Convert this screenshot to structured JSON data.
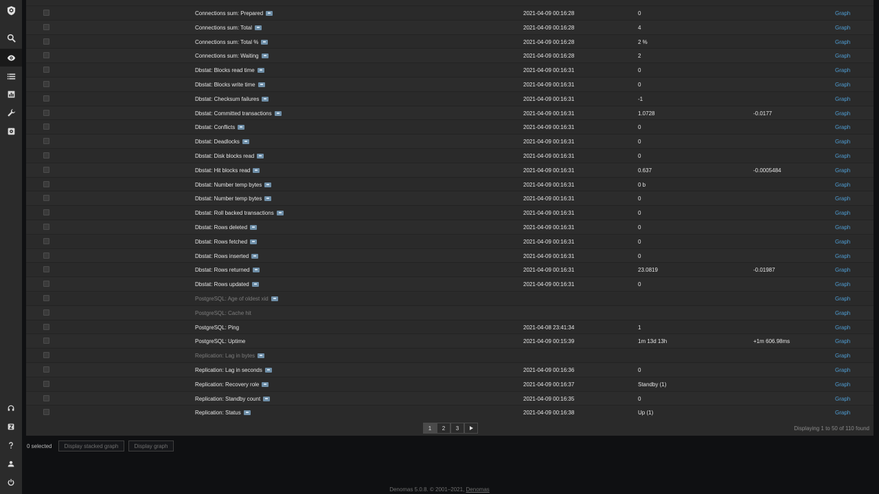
{
  "sidebar": {
    "top": [
      "logo-icon",
      "search-icon",
      "eye-icon",
      "list-icon",
      "chart-icon",
      "wrench-icon",
      "cog-icon"
    ],
    "bottom": [
      "headset-icon",
      "z-icon",
      "help-icon",
      "user-icon",
      "power-icon"
    ]
  },
  "rows": [
    {
      "name": "Connections sum: Prepared",
      "tag": true,
      "time": "2021-04-09 00:16:28",
      "value": "0",
      "change": "",
      "link": "Graph"
    },
    {
      "name": "Connections sum: Total",
      "tag": true,
      "time": "2021-04-09 00:16:28",
      "value": "4",
      "change": "",
      "link": "Graph"
    },
    {
      "name": "Connections sum: Total %",
      "tag": true,
      "time": "2021-04-09 00:16:28",
      "value": "2 %",
      "change": "",
      "link": "Graph"
    },
    {
      "name": "Connections sum: Waiting",
      "tag": true,
      "time": "2021-04-09 00:16:28",
      "value": "2",
      "change": "",
      "link": "Graph"
    },
    {
      "name": "Dbstat: Blocks read time",
      "tag": true,
      "time": "2021-04-09 00:16:31",
      "value": "0",
      "change": "",
      "link": "Graph"
    },
    {
      "name": "Dbstat: Blocks write time",
      "tag": true,
      "time": "2021-04-09 00:16:31",
      "value": "0",
      "change": "",
      "link": "Graph"
    },
    {
      "name": "Dbstat: Checksum failures",
      "tag": true,
      "time": "2021-04-09 00:16:31",
      "value": "-1",
      "change": "",
      "link": "Graph"
    },
    {
      "name": "Dbstat: Committed transactions",
      "tag": true,
      "time": "2021-04-09 00:16:31",
      "value": "1.0728",
      "change": "-0.0177",
      "link": "Graph"
    },
    {
      "name": "Dbstat: Conflicts",
      "tag": true,
      "time": "2021-04-09 00:16:31",
      "value": "0",
      "change": "",
      "link": "Graph"
    },
    {
      "name": "Dbstat: Deadlocks",
      "tag": true,
      "time": "2021-04-09 00:16:31",
      "value": "0",
      "change": "",
      "link": "Graph"
    },
    {
      "name": "Dbstat: Disk blocks read",
      "tag": true,
      "time": "2021-04-09 00:16:31",
      "value": "0",
      "change": "",
      "link": "Graph"
    },
    {
      "name": "Dbstat: Hit blocks read",
      "tag": true,
      "time": "2021-04-09 00:16:31",
      "value": "0.637",
      "change": "-0.0005484",
      "link": "Graph"
    },
    {
      "name": "Dbstat: Number temp bytes",
      "tag": true,
      "time": "2021-04-09 00:16:31",
      "value": "0 b",
      "change": "",
      "link": "Graph"
    },
    {
      "name": "Dbstat: Number temp bytes",
      "tag": true,
      "time": "2021-04-09 00:16:31",
      "value": "0",
      "change": "",
      "link": "Graph"
    },
    {
      "name": "Dbstat: Roll backed transactions",
      "tag": true,
      "time": "2021-04-09 00:16:31",
      "value": "0",
      "change": "",
      "link": "Graph"
    },
    {
      "name": "Dbstat: Rows deleted",
      "tag": true,
      "time": "2021-04-09 00:16:31",
      "value": "0",
      "change": "",
      "link": "Graph"
    },
    {
      "name": "Dbstat: Rows fetched",
      "tag": true,
      "time": "2021-04-09 00:16:31",
      "value": "0",
      "change": "",
      "link": "Graph"
    },
    {
      "name": "Dbstat: Rows inserted",
      "tag": true,
      "time": "2021-04-09 00:16:31",
      "value": "0",
      "change": "",
      "link": "Graph"
    },
    {
      "name": "Dbstat: Rows returned",
      "tag": true,
      "time": "2021-04-09 00:16:31",
      "value": "23.0819",
      "change": "-0.01987",
      "link": "Graph"
    },
    {
      "name": "Dbstat: Rows updated",
      "tag": true,
      "time": "2021-04-09 00:16:31",
      "value": "0",
      "change": "",
      "link": "Graph"
    },
    {
      "name": "PostgreSQL: Age of oldest xid",
      "tag": true,
      "dim": true,
      "time": "",
      "value": "",
      "change": "",
      "link": "Graph"
    },
    {
      "name": "PostgreSQL: Cache hit",
      "tag": false,
      "dim": true,
      "time": "",
      "value": "",
      "change": "",
      "link": "Graph"
    },
    {
      "name": "PostgreSQL: Ping",
      "tag": false,
      "time": "2021-04-08 23:41:34",
      "value": "1",
      "change": "",
      "link": "Graph"
    },
    {
      "name": "PostgreSQL: Uptime",
      "tag": false,
      "time": "2021-04-09 00:15:39",
      "value": "1m 13d 13h",
      "change": "+1m 606.98ms",
      "link": "Graph"
    },
    {
      "name": "Replication: Lag in bytes",
      "tag": true,
      "dim": true,
      "time": "",
      "value": "",
      "change": "",
      "link": "Graph"
    },
    {
      "name": "Replication: Lag in seconds",
      "tag": true,
      "time": "2021-04-09 00:16:36",
      "value": "0",
      "change": "",
      "link": "Graph"
    },
    {
      "name": "Replication: Recovery role",
      "tag": true,
      "time": "2021-04-09 00:16:37",
      "value": "Standby (1)",
      "change": "",
      "link": "Graph"
    },
    {
      "name": "Replication: Standby count",
      "tag": true,
      "time": "2021-04-09 00:16:35",
      "value": "0",
      "change": "",
      "link": "Graph"
    },
    {
      "name": "Replication: Status",
      "tag": true,
      "time": "2021-04-09 00:16:38",
      "value": "Up (1)",
      "change": "",
      "link": "Graph"
    }
  ],
  "pagination": {
    "pages": [
      "1",
      "2",
      "3"
    ],
    "current": "1",
    "next_icon": "next-arrow-icon"
  },
  "displaying": "Displaying 1 to 50 of 110 found",
  "selected": "0 selected",
  "buttons": {
    "stacked": "Display stacked graph",
    "graph": "Display graph"
  },
  "footer": {
    "text": "Denomas 5.0.8. © 2001–2021,",
    "link": "Denomas"
  },
  "colors": {
    "link": "#4f9fd6",
    "background": "#0f1012",
    "sidebar": "#2b2b2b",
    "table": "#2a2a2a"
  }
}
